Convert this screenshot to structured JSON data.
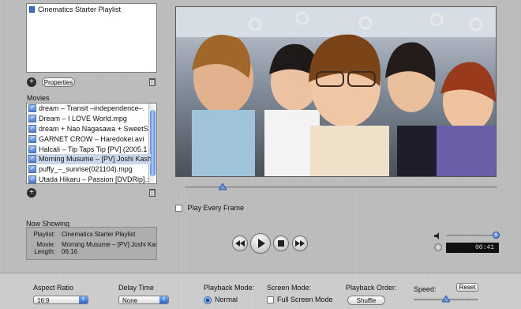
{
  "playlists": {
    "items": [
      {
        "label": "Cinematics Starter Playlist",
        "selected": false
      }
    ],
    "add_label": "+",
    "properties_label": "Properties"
  },
  "movies": {
    "header": "Movies",
    "add_label": "+",
    "items": [
      {
        "label": "dream – Transit –independence–.",
        "checked": true,
        "selected": false
      },
      {
        "label": "Dream – I LOVE World.mpg",
        "checked": true,
        "selected": false
      },
      {
        "label": "dream + Nao Nagasawa + SweetS",
        "checked": true,
        "selected": false
      },
      {
        "label": "GARNET CROW – Haredokei.avi",
        "checked": true,
        "selected": false
      },
      {
        "label": "Halcali – Tip Taps Tip [PV] (2005.1",
        "checked": true,
        "selected": false
      },
      {
        "label": "Morning Musume – [PV] Joshi Kash",
        "checked": true,
        "selected": true
      },
      {
        "label": "puffy_–_sunrise(021104).mpg",
        "checked": true,
        "selected": false
      },
      {
        "label": "Utada Hikaru – Passion [DVDRip].:",
        "checked": true,
        "selected": false
      }
    ]
  },
  "player": {
    "play_every_frame_label": "Play Every Frame",
    "play_every_frame_checked": false,
    "position_fraction": 0.12,
    "volume_fraction": 0.95,
    "time": "00:41"
  },
  "now_showing": {
    "title": "Now Showing",
    "playlist_label": "Playlist:",
    "playlist_value": "Cinematics Starter Playlist",
    "movie_label": "Movie:",
    "movie_value": "Morning Musume – [PV] Joshi Kash",
    "length_label": "Length:",
    "length_value": "06:16"
  },
  "settings": {
    "aspect_label": "Aspect Ratio",
    "aspect_value": "16:9",
    "delay_label": "Delay Time",
    "delay_value": "None",
    "playback_mode_label": "Playback Mode:",
    "playback_mode_value": "Normal",
    "screen_mode_label": "Screen Mode:",
    "full_screen_label": "Full Screen Mode",
    "playback_order_label": "Playback Order:",
    "shuffle_label": "Shuffle",
    "speed_label": "Speed:",
    "reset_label": "Reset",
    "speed_fraction": 0.5
  },
  "colors": {
    "accent": "#3d6fd0",
    "selection": "#cdd7ea"
  }
}
